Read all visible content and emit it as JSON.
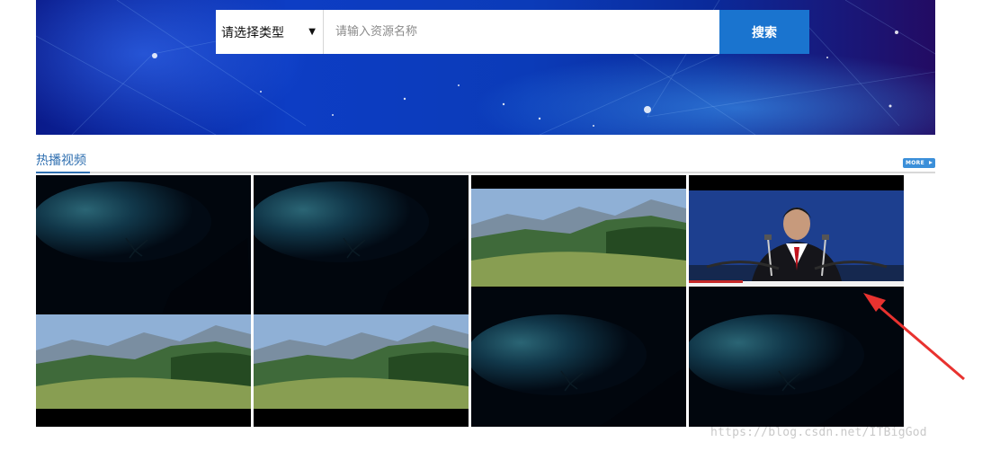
{
  "search": {
    "type_label": "请选择类型",
    "placeholder": "请输入资源名称",
    "button_label": "搜索"
  },
  "section": {
    "title": "热播视频",
    "more_label": "MORE"
  },
  "videos": [
    {
      "top_scene": "space",
      "bottom_scene": "landscape"
    },
    {
      "top_scene": "space",
      "bottom_scene": "landscape"
    },
    {
      "top_scene": "landscape",
      "bottom_scene": "space"
    },
    {
      "top_scene": "speaker",
      "bottom_scene": "space"
    }
  ],
  "watermark": "https://blog.csdn.net/ITBigGod",
  "colors": {
    "accent": "#1a74cf",
    "section_title": "#2f6fb0",
    "annotation_arrow": "#e8322f"
  }
}
